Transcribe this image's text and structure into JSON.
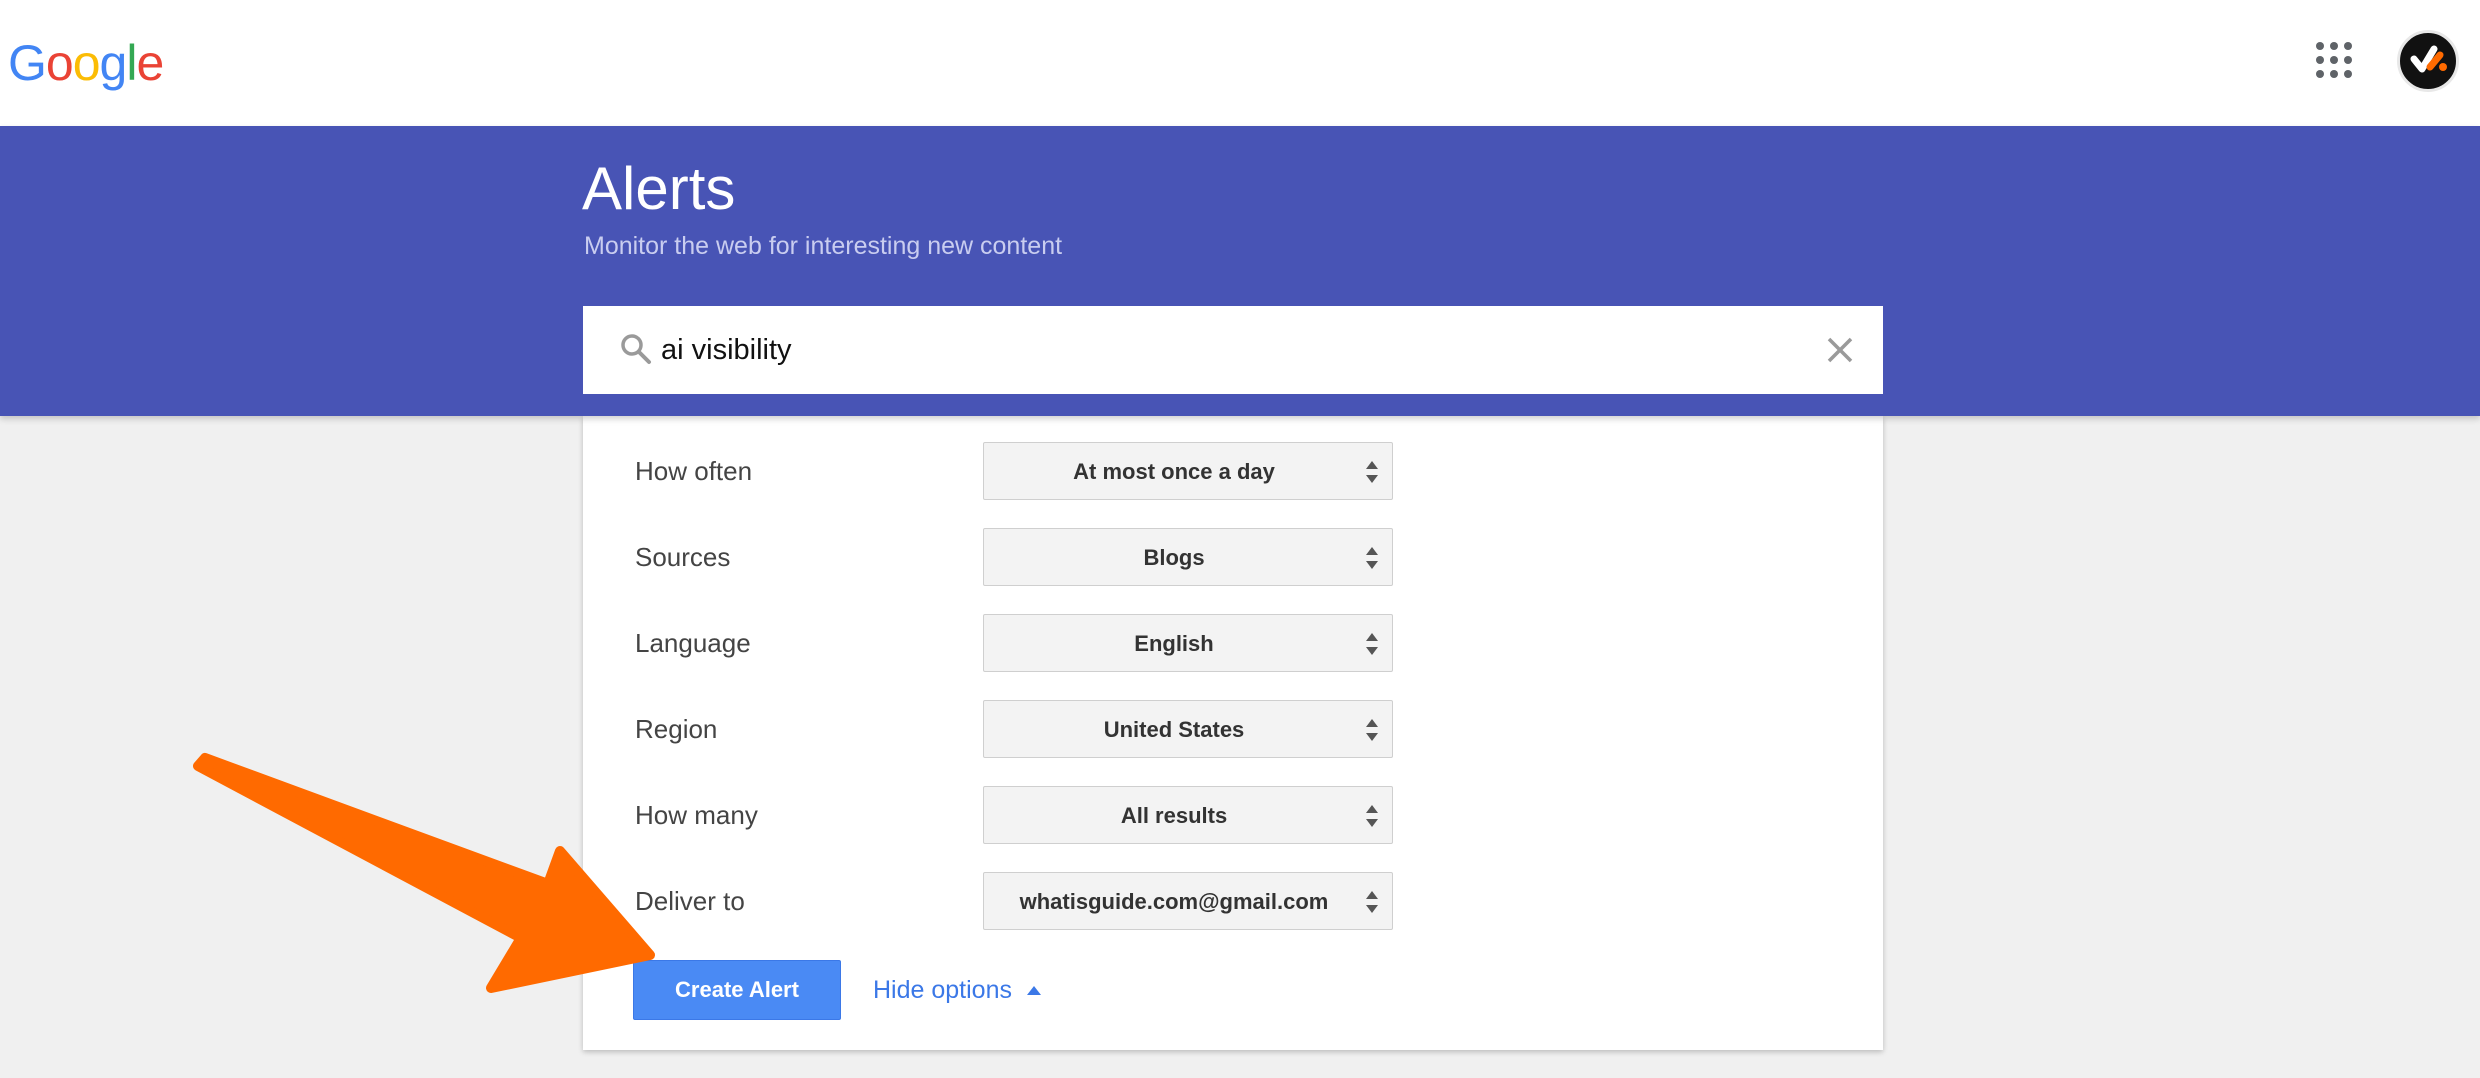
{
  "header": {
    "logo_letters": [
      {
        "ch": "G",
        "color": "#4285f4"
      },
      {
        "ch": "o",
        "color": "#ea4335"
      },
      {
        "ch": "o",
        "color": "#fbbc05"
      },
      {
        "ch": "g",
        "color": "#4285f4"
      },
      {
        "ch": "l",
        "color": "#34a853"
      },
      {
        "ch": "e",
        "color": "#ea4335"
      }
    ],
    "apps_icon": "apps-grid-icon",
    "avatar_icon": "account-avatar-icon"
  },
  "banner": {
    "title": "Alerts",
    "subtitle": "Monitor the web for interesting new content",
    "color": "#4854b5"
  },
  "search": {
    "value": "ai visibility",
    "search_icon": "search-icon",
    "clear_icon": "close-icon"
  },
  "options": [
    {
      "label": "How often",
      "value": "At most once a day"
    },
    {
      "label": "Sources",
      "value": "Blogs"
    },
    {
      "label": "Language",
      "value": "English"
    },
    {
      "label": "Region",
      "value": "United States"
    },
    {
      "label": "How many",
      "value": "All results"
    },
    {
      "label": "Deliver to",
      "value": "whatisguide.com@gmail.com"
    }
  ],
  "actions": {
    "create_label": "Create Alert",
    "hide_options_label": "Hide options",
    "accent_color": "#4a8af4"
  },
  "annotation": {
    "arrow_color": "#ff6a00"
  }
}
